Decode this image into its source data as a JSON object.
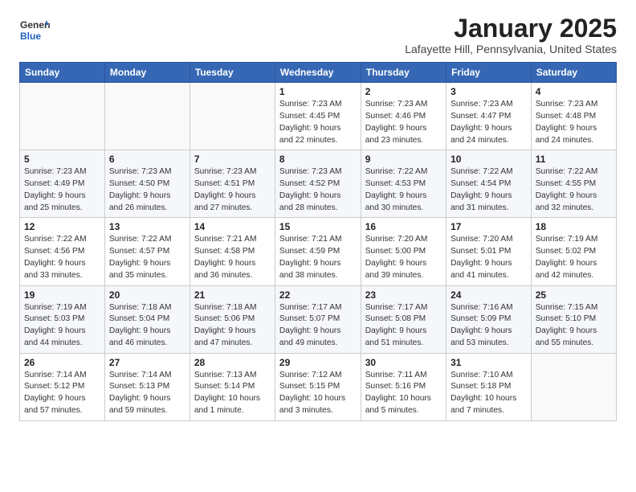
{
  "header": {
    "logo_general": "General",
    "logo_blue": "Blue",
    "title": "January 2025",
    "location": "Lafayette Hill, Pennsylvania, United States"
  },
  "columns": [
    "Sunday",
    "Monday",
    "Tuesday",
    "Wednesday",
    "Thursday",
    "Friday",
    "Saturday"
  ],
  "weeks": [
    [
      {
        "day": "",
        "info": ""
      },
      {
        "day": "",
        "info": ""
      },
      {
        "day": "",
        "info": ""
      },
      {
        "day": "1",
        "info": "Sunrise: 7:23 AM\nSunset: 4:45 PM\nDaylight: 9 hours\nand 22 minutes."
      },
      {
        "day": "2",
        "info": "Sunrise: 7:23 AM\nSunset: 4:46 PM\nDaylight: 9 hours\nand 23 minutes."
      },
      {
        "day": "3",
        "info": "Sunrise: 7:23 AM\nSunset: 4:47 PM\nDaylight: 9 hours\nand 24 minutes."
      },
      {
        "day": "4",
        "info": "Sunrise: 7:23 AM\nSunset: 4:48 PM\nDaylight: 9 hours\nand 24 minutes."
      }
    ],
    [
      {
        "day": "5",
        "info": "Sunrise: 7:23 AM\nSunset: 4:49 PM\nDaylight: 9 hours\nand 25 minutes."
      },
      {
        "day": "6",
        "info": "Sunrise: 7:23 AM\nSunset: 4:50 PM\nDaylight: 9 hours\nand 26 minutes."
      },
      {
        "day": "7",
        "info": "Sunrise: 7:23 AM\nSunset: 4:51 PM\nDaylight: 9 hours\nand 27 minutes."
      },
      {
        "day": "8",
        "info": "Sunrise: 7:23 AM\nSunset: 4:52 PM\nDaylight: 9 hours\nand 28 minutes."
      },
      {
        "day": "9",
        "info": "Sunrise: 7:22 AM\nSunset: 4:53 PM\nDaylight: 9 hours\nand 30 minutes."
      },
      {
        "day": "10",
        "info": "Sunrise: 7:22 AM\nSunset: 4:54 PM\nDaylight: 9 hours\nand 31 minutes."
      },
      {
        "day": "11",
        "info": "Sunrise: 7:22 AM\nSunset: 4:55 PM\nDaylight: 9 hours\nand 32 minutes."
      }
    ],
    [
      {
        "day": "12",
        "info": "Sunrise: 7:22 AM\nSunset: 4:56 PM\nDaylight: 9 hours\nand 33 minutes."
      },
      {
        "day": "13",
        "info": "Sunrise: 7:22 AM\nSunset: 4:57 PM\nDaylight: 9 hours\nand 35 minutes."
      },
      {
        "day": "14",
        "info": "Sunrise: 7:21 AM\nSunset: 4:58 PM\nDaylight: 9 hours\nand 36 minutes."
      },
      {
        "day": "15",
        "info": "Sunrise: 7:21 AM\nSunset: 4:59 PM\nDaylight: 9 hours\nand 38 minutes."
      },
      {
        "day": "16",
        "info": "Sunrise: 7:20 AM\nSunset: 5:00 PM\nDaylight: 9 hours\nand 39 minutes."
      },
      {
        "day": "17",
        "info": "Sunrise: 7:20 AM\nSunset: 5:01 PM\nDaylight: 9 hours\nand 41 minutes."
      },
      {
        "day": "18",
        "info": "Sunrise: 7:19 AM\nSunset: 5:02 PM\nDaylight: 9 hours\nand 42 minutes."
      }
    ],
    [
      {
        "day": "19",
        "info": "Sunrise: 7:19 AM\nSunset: 5:03 PM\nDaylight: 9 hours\nand 44 minutes."
      },
      {
        "day": "20",
        "info": "Sunrise: 7:18 AM\nSunset: 5:04 PM\nDaylight: 9 hours\nand 46 minutes."
      },
      {
        "day": "21",
        "info": "Sunrise: 7:18 AM\nSunset: 5:06 PM\nDaylight: 9 hours\nand 47 minutes."
      },
      {
        "day": "22",
        "info": "Sunrise: 7:17 AM\nSunset: 5:07 PM\nDaylight: 9 hours\nand 49 minutes."
      },
      {
        "day": "23",
        "info": "Sunrise: 7:17 AM\nSunset: 5:08 PM\nDaylight: 9 hours\nand 51 minutes."
      },
      {
        "day": "24",
        "info": "Sunrise: 7:16 AM\nSunset: 5:09 PM\nDaylight: 9 hours\nand 53 minutes."
      },
      {
        "day": "25",
        "info": "Sunrise: 7:15 AM\nSunset: 5:10 PM\nDaylight: 9 hours\nand 55 minutes."
      }
    ],
    [
      {
        "day": "26",
        "info": "Sunrise: 7:14 AM\nSunset: 5:12 PM\nDaylight: 9 hours\nand 57 minutes."
      },
      {
        "day": "27",
        "info": "Sunrise: 7:14 AM\nSunset: 5:13 PM\nDaylight: 9 hours\nand 59 minutes."
      },
      {
        "day": "28",
        "info": "Sunrise: 7:13 AM\nSunset: 5:14 PM\nDaylight: 10 hours\nand 1 minute."
      },
      {
        "day": "29",
        "info": "Sunrise: 7:12 AM\nSunset: 5:15 PM\nDaylight: 10 hours\nand 3 minutes."
      },
      {
        "day": "30",
        "info": "Sunrise: 7:11 AM\nSunset: 5:16 PM\nDaylight: 10 hours\nand 5 minutes."
      },
      {
        "day": "31",
        "info": "Sunrise: 7:10 AM\nSunset: 5:18 PM\nDaylight: 10 hours\nand 7 minutes."
      },
      {
        "day": "",
        "info": ""
      }
    ]
  ]
}
